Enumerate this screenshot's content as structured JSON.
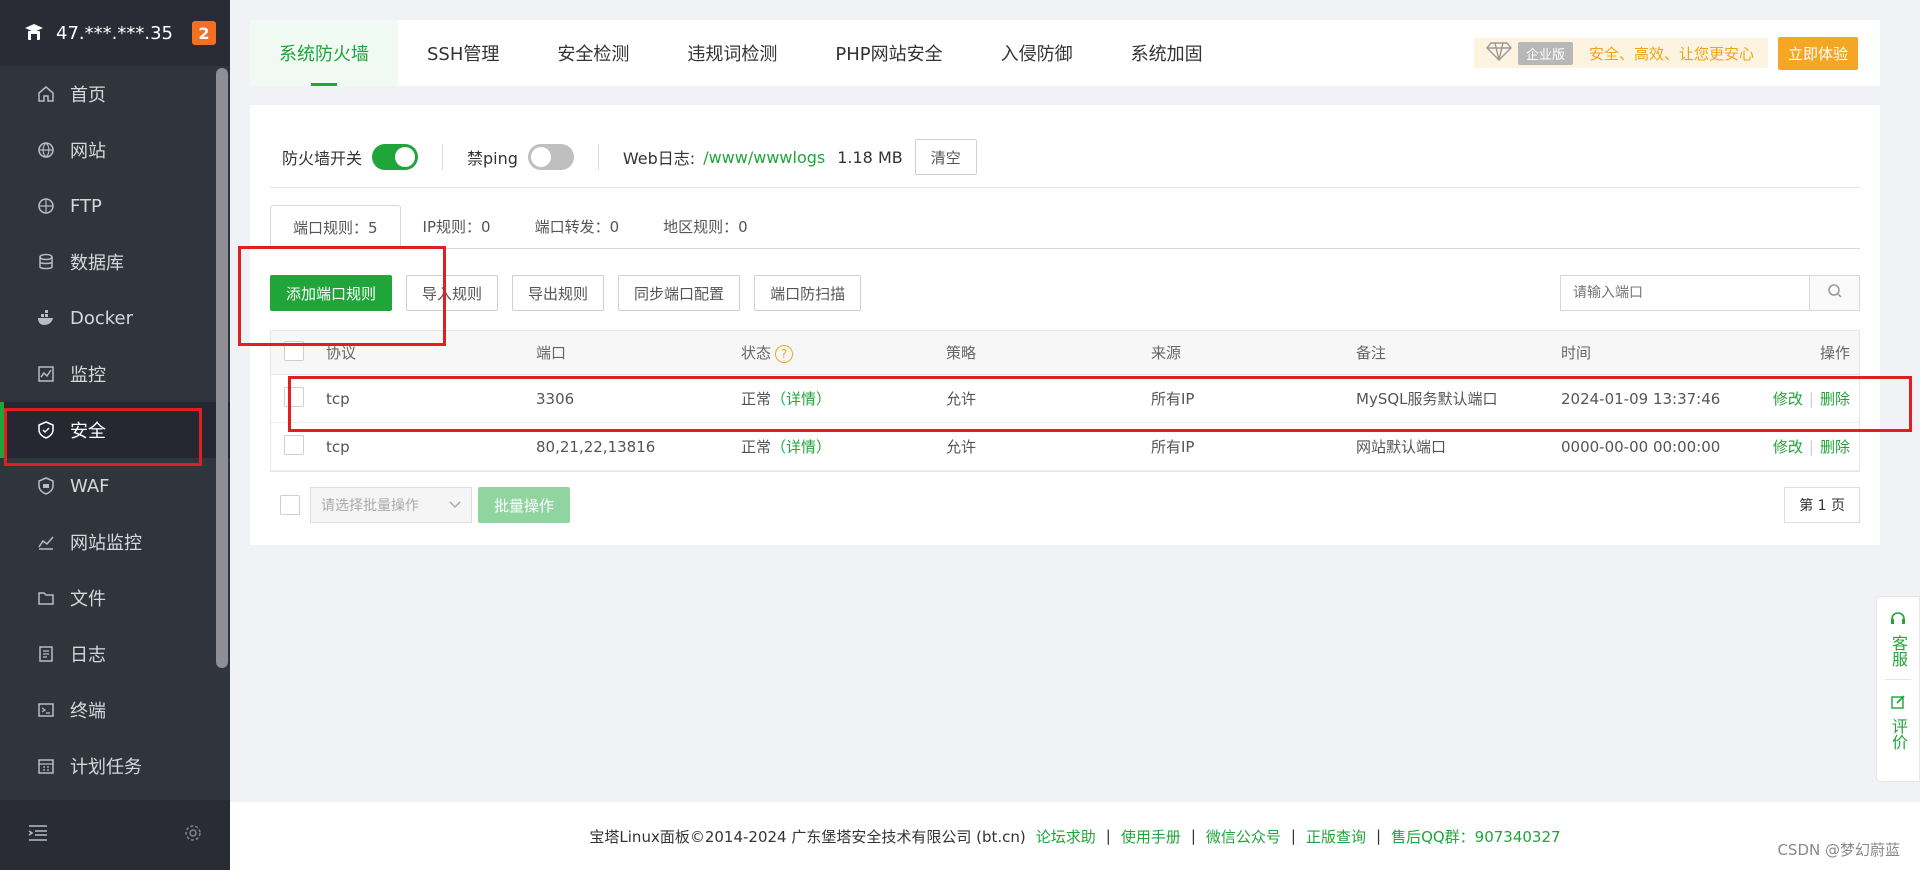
{
  "sidebar": {
    "server_ip": "47.***.***.35",
    "badge_count": "2",
    "items": [
      {
        "label": "首页",
        "icon": "home-icon"
      },
      {
        "label": "网站",
        "icon": "globe-icon"
      },
      {
        "label": "FTP",
        "icon": "ftp-icon"
      },
      {
        "label": "数据库",
        "icon": "database-icon"
      },
      {
        "label": "Docker",
        "icon": "docker-icon"
      },
      {
        "label": "监控",
        "icon": "monitor-icon"
      },
      {
        "label": "安全",
        "icon": "shield-icon",
        "active": true
      },
      {
        "label": "WAF",
        "icon": "waf-icon"
      },
      {
        "label": "网站监控",
        "icon": "chart-icon"
      },
      {
        "label": "文件",
        "icon": "folder-icon"
      },
      {
        "label": "日志",
        "icon": "log-icon"
      },
      {
        "label": "终端",
        "icon": "terminal-icon"
      },
      {
        "label": "计划任务",
        "icon": "calendar-icon"
      }
    ]
  },
  "top_tabs": [
    {
      "label": "系统防火墙",
      "active": true
    },
    {
      "label": "SSH管理"
    },
    {
      "label": "安全检测"
    },
    {
      "label": "违规词检测"
    },
    {
      "label": "PHP网站安全"
    },
    {
      "label": "入侵防御"
    },
    {
      "label": "系统加固"
    }
  ],
  "enterprise": {
    "tag": "企业版",
    "slogan": "安全、高效、让您更安心",
    "button": "立即体验"
  },
  "switches": {
    "firewall_label": "防火墙开关",
    "firewall_on": true,
    "ping_label": "禁ping",
    "ping_on": false,
    "weblog_label": "Web日志:",
    "weblog_path": "/www/wwwlogs",
    "weblog_size": "1.18 MB",
    "clear_button": "清空"
  },
  "sub_tabs": [
    {
      "label": "端口规则：5",
      "active": true
    },
    {
      "label": "IP规则：0"
    },
    {
      "label": "端口转发：0"
    },
    {
      "label": "地区规则：0"
    }
  ],
  "actions": {
    "add": "添加端口规则",
    "import": "导入规则",
    "export": "导出规则",
    "sync": "同步端口配置",
    "antiscan": "端口防扫描",
    "search_placeholder": "请输入端口"
  },
  "table": {
    "headers": {
      "protocol": "协议",
      "port": "端口",
      "status": "状态",
      "policy": "策略",
      "source": "来源",
      "note": "备注",
      "time": "时间",
      "ops": "操作"
    },
    "rows": [
      {
        "protocol": "tcp",
        "port": "3306",
        "status": "正常",
        "detail": "（详情）",
        "policy": "允许",
        "source": "所有IP",
        "note": "MySQL服务默认端口",
        "time": "2024-01-09 13:37:46",
        "edit": "修改",
        "delete": "删除"
      },
      {
        "protocol": "tcp",
        "port": "80,21,22,13816",
        "status": "正常",
        "detail": "（详情）",
        "policy": "允许",
        "source": "所有IP",
        "note": "网站默认端口",
        "time": "0000-00-00 00:00:00",
        "edit": "修改",
        "delete": "删除"
      }
    ]
  },
  "bottom": {
    "batch_select_placeholder": "请选择批量操作",
    "batch_button": "批量操作",
    "page": "第 1 页"
  },
  "float_service": {
    "service": "客服",
    "review": "评价"
  },
  "footer": {
    "copyright": "宝塔Linux面板©2014-2024 广东堡塔安全技术有限公司 (bt.cn)",
    "links": [
      "论坛求助",
      "使用手册",
      "微信公众号",
      "正版查询",
      "售后QQ群：907340327"
    ]
  },
  "watermark": "CSDN @梦幻蔚蓝",
  "colors": {
    "accent": "#20a53a",
    "sidebar_bg": "#30343d",
    "highlight_box": "#e02020",
    "enterprise_orange": "#f5a623"
  }
}
